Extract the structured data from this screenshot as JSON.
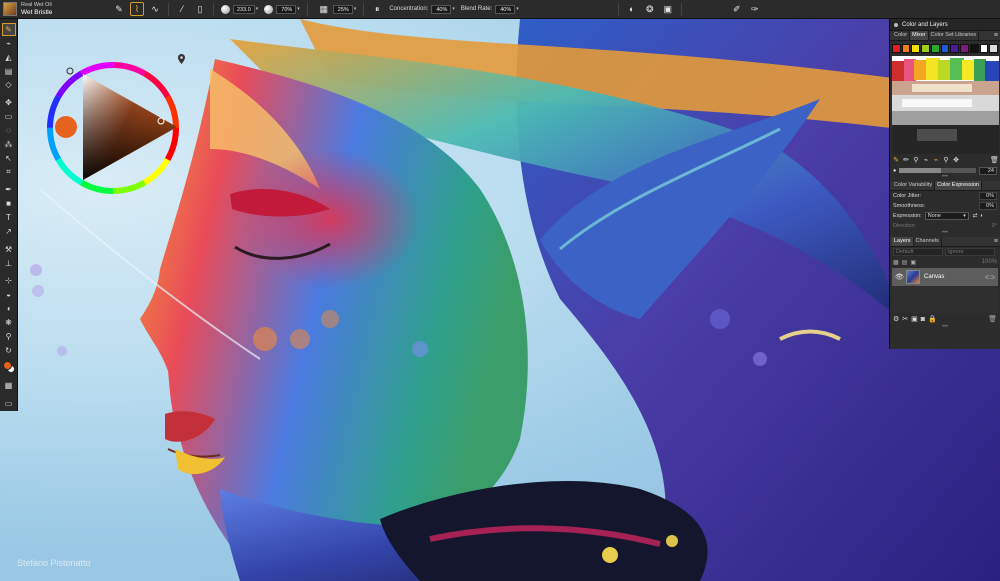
{
  "app": {
    "brush_category": "Real Wet Oil",
    "brush_variant": "Wet Bristle"
  },
  "topbar": {
    "size_value": "233.0",
    "opacity_value": "70%",
    "grain_value": "25%",
    "concentration_label": "Concentration:",
    "concentration_value": "40%",
    "blend_rate_label": "Blend Rate:",
    "blend_rate_value": "40%",
    "icons": [
      "brush-stroke-icon",
      "dab-type-icon",
      "stroke-path-icon",
      "cover-brush-icon",
      "jitter-icon",
      "size-icon",
      "opacity-icon",
      "grain-icon",
      "pause-icon",
      "stamp-icon",
      "texture-icon",
      "clone-icon",
      "brush-settings-icon",
      "brush-tools-icon"
    ]
  },
  "toolbox": {
    "tools": [
      "brush-tool-icon",
      "dropper-tool-icon",
      "paint-bucket-icon",
      "gradient-icon",
      "eraser-icon",
      "transform-icon",
      "rectangle-select-icon",
      "lasso-icon",
      "magic-wand-icon",
      "layer-adjuster-icon",
      "crop-icon",
      "pen-icon",
      "shape-icon",
      "text-icon",
      "selection-adjuster-icon",
      "cloner-icon",
      "rubber-stamp-icon",
      "dodge-icon",
      "burn-icon",
      "mirror-icon",
      "kaleidoscope-icon",
      "magnifier-icon",
      "rotate-page-icon",
      "grabber-icon",
      "paper-icon",
      "screen-mode-icon"
    ],
    "main_color": "#e8621f",
    "additional_color": "#ffffff"
  },
  "color_wheel": {
    "hue_color": "#e8621f"
  },
  "panel": {
    "title": "Color and Layers",
    "color_tabs": [
      "Color",
      "Mixer",
      "Color Set Libraries"
    ],
    "color_set_swatches": [
      "#e02020",
      "#f07a1a",
      "#f5e000",
      "#9ad01c",
      "#2ca82c",
      "#1c5ad8",
      "#4a1c9c",
      "#7a1c7a",
      "#111111",
      "#ffffff",
      "#dddddd"
    ],
    "mixer_size_value": "24",
    "mixer_size_fill": 0.55,
    "expression_tabs": [
      "Color Variability",
      "Color Expression"
    ],
    "color_jitter_label": "Color Jitter:",
    "color_jitter_value": "0%",
    "smoothness_label": "Smoothness:",
    "smoothness_value": "0%",
    "expression_label": "Expression:",
    "expression_value": "None",
    "direction_label": "Direction:",
    "direction_value": "0°",
    "layers_tabs": [
      "Layers",
      "Channels"
    ],
    "composite_method": "Default",
    "composite_depth": "Ignore",
    "layer_opacity": "100%",
    "layer_name": "Canvas"
  },
  "credit": "Stefano Pistonatto"
}
